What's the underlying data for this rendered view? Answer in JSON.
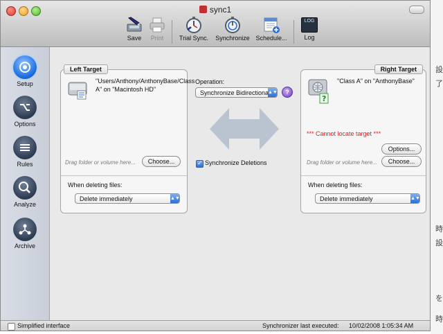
{
  "window": {
    "title": "sync1"
  },
  "toolbar": {
    "save": "Save",
    "print": "Print",
    "trial_sync": "Trial Sync.",
    "synchronize": "Synchronize",
    "schedule": "Schedule...",
    "log": "Log",
    "log_icon_text": "LOG"
  },
  "sidebar": {
    "items": [
      {
        "label": "Setup"
      },
      {
        "label": "Options"
      },
      {
        "label": "Rules"
      },
      {
        "label": "Analyze"
      },
      {
        "label": "Archive"
      }
    ]
  },
  "left_target": {
    "tab": "Left Target",
    "path": "\"Users/Anthony/AnthonyBase/Class A\" on \"Macintosh HD\"",
    "hint": "Drag folder or volume here...",
    "choose": "Choose...",
    "deleting_label": "When deleting files:",
    "deleting_value": "Delete immediately"
  },
  "operation": {
    "label": "Operation:",
    "value": "Synchronize Bidirectional",
    "help": "?",
    "sync_deletions": "Synchronize Deletions",
    "sync_deletions_checked": true
  },
  "right_target": {
    "tab": "Right Target",
    "path": "\"Class A\" on \"AnthonyBase\"",
    "error": "*** Cannot locate target ***",
    "options": "Options...",
    "hint": "Drag folder or volume here...",
    "choose": "Choose...",
    "deleting_label": "When deleting files:",
    "deleting_value": "Delete immediately"
  },
  "statusbar": {
    "simplified": "Simplified interface",
    "last_executed_label": "Synchronizer last executed:",
    "last_executed_value": "10/02/2008 1:05:34 AM"
  },
  "desktop": {
    "glyphs": [
      "設",
      "了",
      "時",
      "設",
      "を",
      "時"
    ]
  },
  "colors": {
    "accent": "#2d6fd6",
    "error": "#e02020",
    "arrow": "#b9c4d0"
  }
}
